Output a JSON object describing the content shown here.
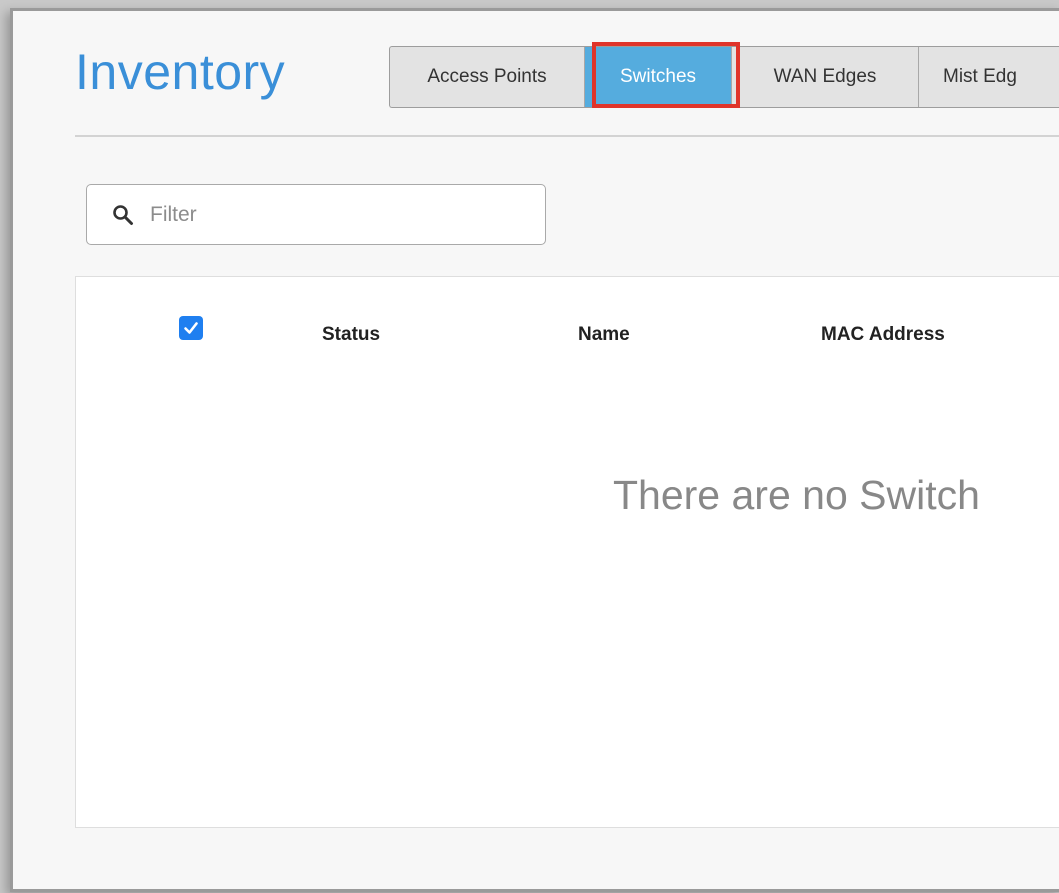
{
  "page": {
    "title": "Inventory"
  },
  "tabs": [
    {
      "label": "Access Points",
      "active": false
    },
    {
      "label": "Switches",
      "active": true
    },
    {
      "label": "WAN Edges",
      "active": false
    },
    {
      "label": "Mist Edg",
      "active": false
    }
  ],
  "filter": {
    "placeholder": "Filter",
    "value": "",
    "icon": "search-icon"
  },
  "table": {
    "select_all_checked": true,
    "columns": [
      "Status",
      "Name",
      "MAC Address"
    ],
    "empty_message": "There are no Switch"
  },
  "colors": {
    "title": "#3a8fd8",
    "active_tab": "#55acde",
    "highlight_box": "#e0342a",
    "checkbox": "#1f7ff0"
  }
}
